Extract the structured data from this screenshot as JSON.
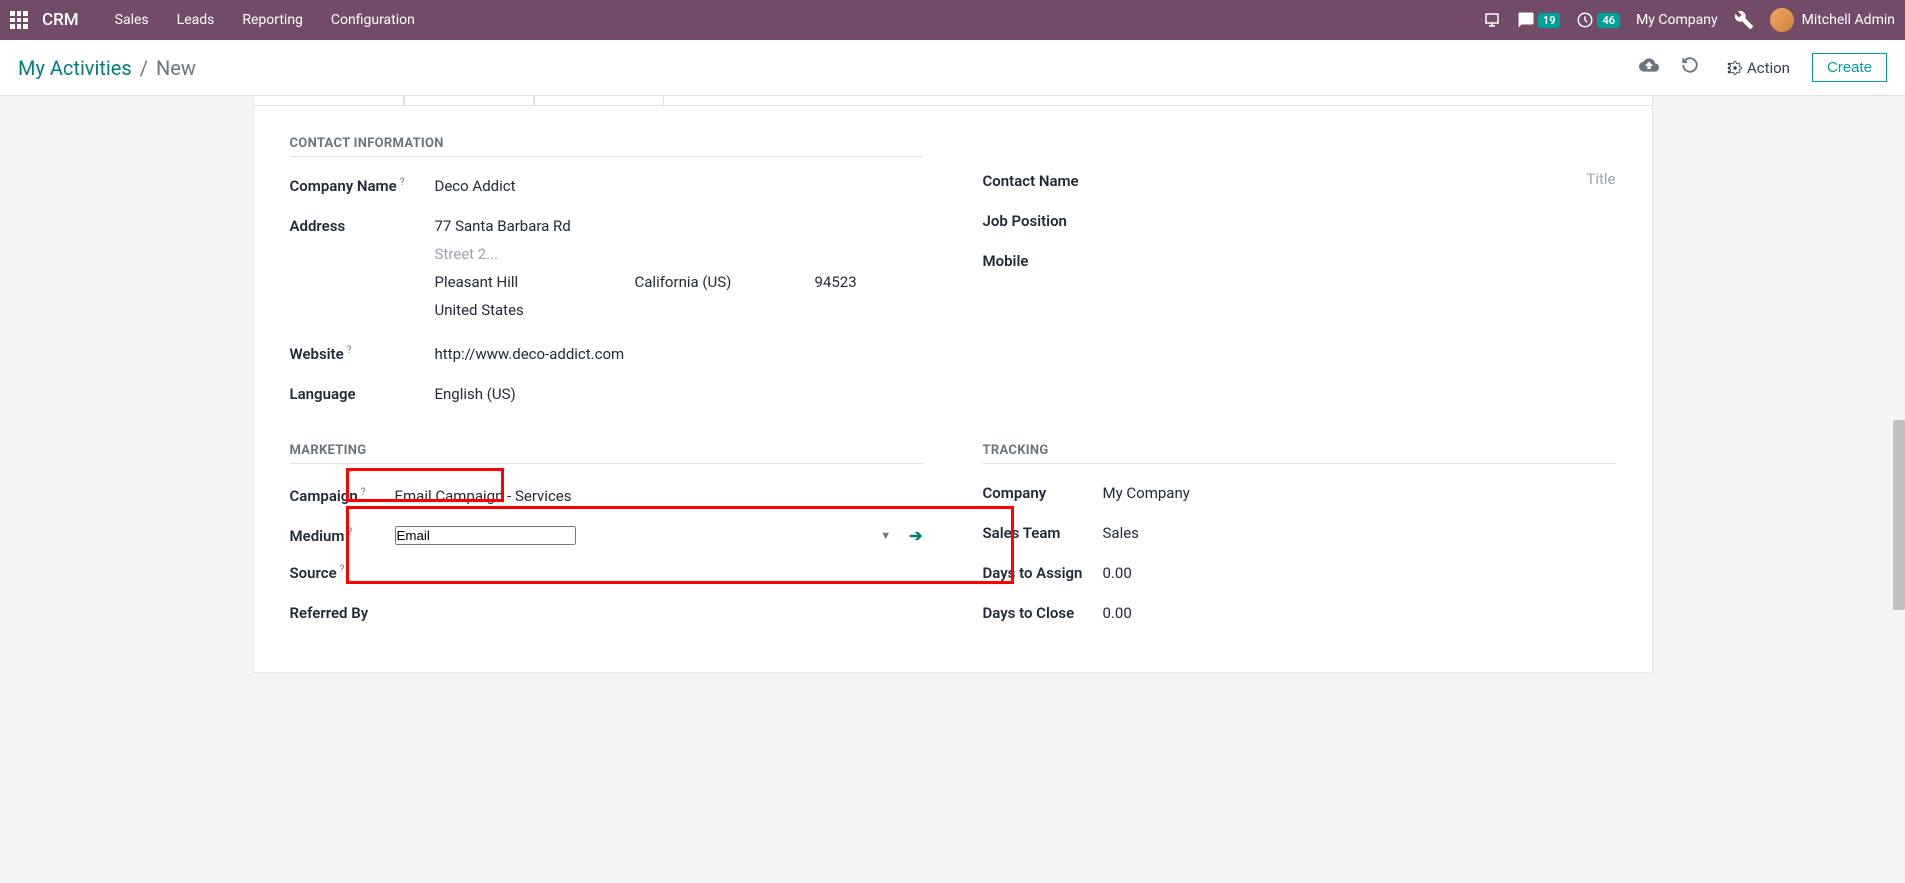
{
  "navbar": {
    "brand": "CRM",
    "items": [
      "Sales",
      "Leads",
      "Reporting",
      "Configuration"
    ],
    "messages_count": "19",
    "activities_count": "46",
    "company": "My Company",
    "user": "Mitchell Admin"
  },
  "breadcrumb": {
    "parent": "My Activities",
    "current": "New"
  },
  "controls": {
    "action": "Action",
    "create": "Create"
  },
  "sections": {
    "contact": "Contact Information",
    "marketing": "Marketing",
    "tracking": "Tracking"
  },
  "labels": {
    "company_name": "Company Name",
    "address": "Address",
    "website": "Website",
    "language": "Language",
    "contact_name": "Contact Name",
    "title_placeholder": "Title",
    "job_position": "Job Position",
    "mobile": "Mobile",
    "campaign": "Campaign",
    "medium": "Medium",
    "source": "Source",
    "referred_by": "Referred By",
    "company": "Company",
    "sales_team": "Sales Team",
    "days_assign": "Days to Assign",
    "days_close": "Days to Close"
  },
  "values": {
    "company_name": "Deco Addict",
    "street": "77 Santa Barbara Rd",
    "street2_placeholder": "Street 2...",
    "city": "Pleasant Hill",
    "state": "California (US)",
    "zip": "94523",
    "country": "United States",
    "website": "http://www.deco-addict.com",
    "language": "English (US)",
    "campaign": "Email Campaign - Services",
    "medium": "Email",
    "company": "My Company",
    "sales_team": "Sales",
    "days_assign": "0.00",
    "days_close": "0.00"
  }
}
